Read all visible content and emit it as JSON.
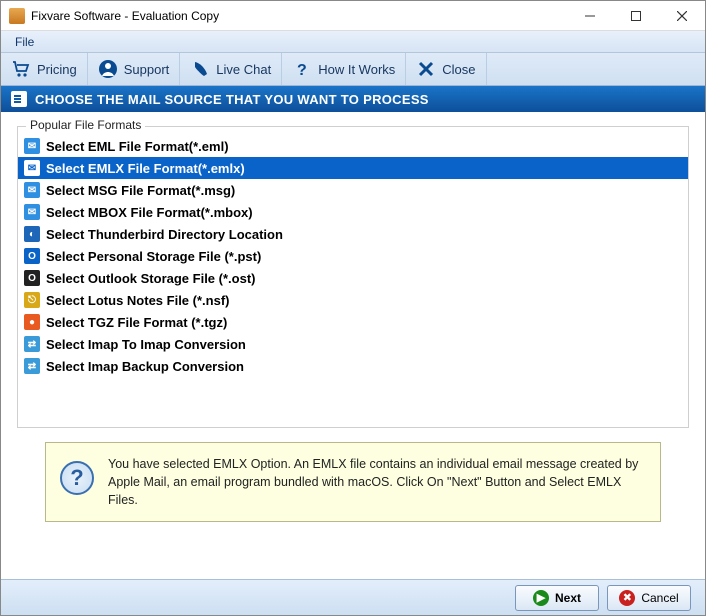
{
  "window": {
    "title": "Fixvare Software - Evaluation Copy"
  },
  "menubar": {
    "file": "File"
  },
  "toolbar": {
    "pricing": "Pricing",
    "support": "Support",
    "livechat": "Live Chat",
    "howitworks": "How It Works",
    "close": "Close"
  },
  "banner": {
    "text": "CHOOSE THE MAIL SOURCE THAT YOU WANT TO PROCESS"
  },
  "formats": {
    "legend": "Popular File Formats",
    "items": [
      {
        "label": "Select EML File Format(*.eml)",
        "icon_bg": "#2f8fe0",
        "glyph": "✉"
      },
      {
        "label": "Select EMLX File Format(*.emlx)",
        "icon_bg": "#ffffff",
        "glyph": "✉",
        "selected": true
      },
      {
        "label": "Select MSG File Format(*.msg)",
        "icon_bg": "#2f8fe0",
        "glyph": "✉"
      },
      {
        "label": "Select MBOX File Format(*.mbox)",
        "icon_bg": "#2f8fe0",
        "glyph": "✉"
      },
      {
        "label": "Select Thunderbird Directory Location",
        "icon_bg": "#1e66b8",
        "glyph": "◐"
      },
      {
        "label": "Select Personal Storage File (*.pst)",
        "icon_bg": "#0a64c8",
        "glyph": "O"
      },
      {
        "label": "Select Outlook Storage File (*.ost)",
        "icon_bg": "#222222",
        "glyph": "O"
      },
      {
        "label": "Select Lotus Notes File (*.nsf)",
        "icon_bg": "#d8a818",
        "glyph": "⎋"
      },
      {
        "label": "Select TGZ File Format (*.tgz)",
        "icon_bg": "#e85a20",
        "glyph": "●"
      },
      {
        "label": "Select Imap To Imap Conversion",
        "icon_bg": "#3a9bd8",
        "glyph": "⇄"
      },
      {
        "label": "Select Imap Backup Conversion",
        "icon_bg": "#3a9bd8",
        "glyph": "⇄"
      }
    ]
  },
  "info": {
    "text": "You have selected EMLX Option. An EMLX file contains an individual email message created by Apple Mail, an email program bundled with macOS. Click On \"Next\" Button and Select EMLX Files."
  },
  "footer": {
    "next": "Next",
    "cancel": "Cancel"
  }
}
